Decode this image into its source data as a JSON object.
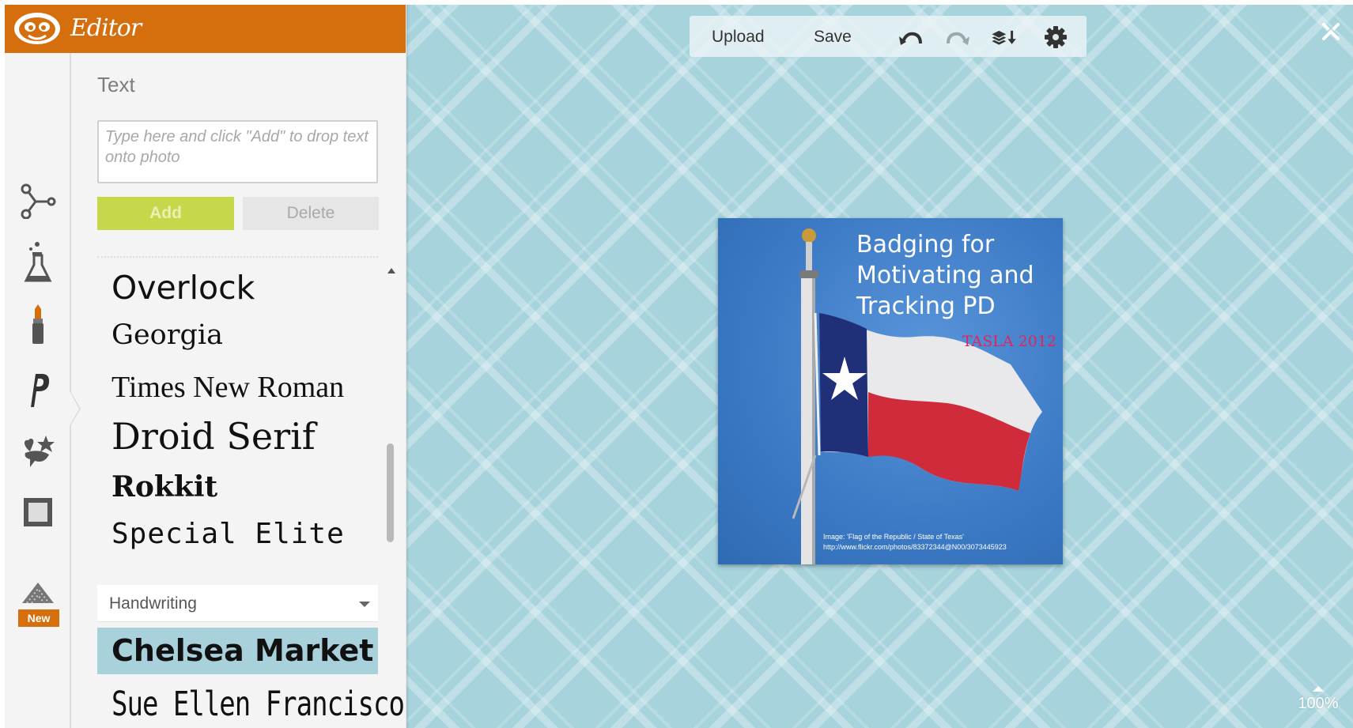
{
  "app": {
    "title": "Editor",
    "brand_color": "#d56e0c"
  },
  "sidebar": {
    "section_label": "Text",
    "text_input": {
      "placeholder": "Type here and click \"Add\" to drop text onto photo",
      "value": ""
    },
    "add_label": "Add",
    "delete_label": "Delete",
    "rail_icons": [
      "effects-icon",
      "lab-icon",
      "touch-up-icon",
      "text-icon",
      "stickers-icon",
      "frames-icon",
      "textures-icon"
    ],
    "rail_new_badge": "New",
    "fonts_top": [
      "Overlock",
      "Georgia",
      "Times New Roman",
      "Droid Serif",
      "Rokkit",
      "Special Elite"
    ],
    "category": "Handwriting",
    "fonts_bottom": [
      "Chelsea Market",
      "Sue Ellen Francisco"
    ],
    "selected_font": "Chelsea Market",
    "selected_color": "#a9d1dc"
  },
  "toolbar": {
    "upload_label": "Upload",
    "save_label": "Save",
    "icons": [
      "undo-icon",
      "redo-icon",
      "layers-icon",
      "settings-icon"
    ]
  },
  "canvas": {
    "background_color": "#a7d3dd",
    "close_icon": "close-icon",
    "zoom_label": "100%"
  },
  "photo": {
    "title_lines": [
      "Badging for",
      "Motivating and",
      "Tracking PD"
    ],
    "event": "TASLA 2012",
    "event_color": "#e0255c",
    "credit_lines": [
      "Image: 'Flag of the Republic / State of Texas'",
      "http://www.flickr.com/photos/83372344@N00/3073445923"
    ]
  }
}
